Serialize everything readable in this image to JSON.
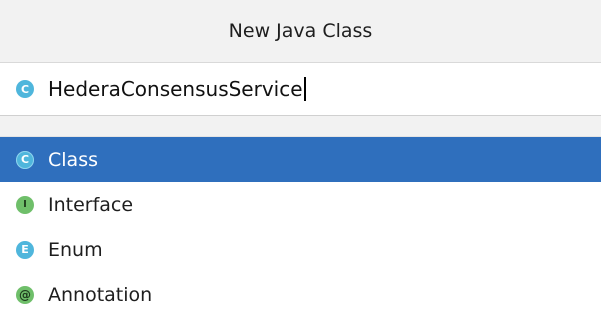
{
  "dialog": {
    "title": "New Java Class"
  },
  "name_field": {
    "icon": "class-icon",
    "icon_glyph": "C",
    "value": "HederaConsensusService"
  },
  "kinds": [
    {
      "label": "Class",
      "icon": "class-icon",
      "glyph": "C",
      "selected": true
    },
    {
      "label": "Interface",
      "icon": "interface-icon",
      "glyph": "I",
      "selected": false
    },
    {
      "label": "Enum",
      "icon": "enum-icon",
      "glyph": "E",
      "selected": false
    },
    {
      "label": "Annotation",
      "icon": "annotation-icon",
      "glyph": "@",
      "selected": false
    }
  ],
  "colors": {
    "selection": "#2f6fbd",
    "class_badge": "#4fb6dc",
    "interface_badge": "#6fbf6a"
  }
}
